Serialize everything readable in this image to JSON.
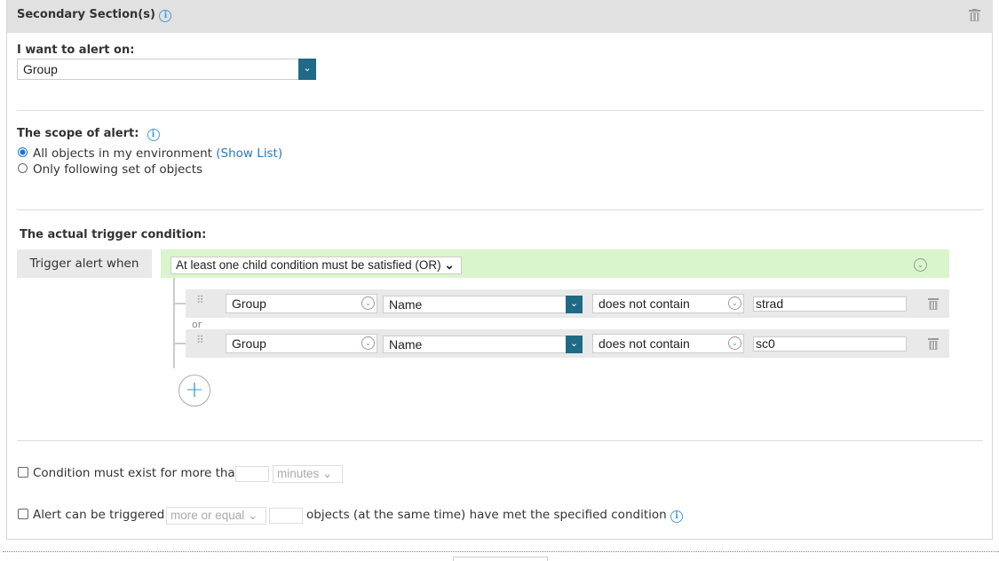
{
  "section": {
    "title": "Secondary Section(s)"
  },
  "alert_on": {
    "label": "I want to alert on:",
    "value": "Group"
  },
  "scope": {
    "label": "The scope of alert:",
    "options": [
      {
        "label": "All objects in my environment",
        "selected": true
      },
      {
        "label": "Only following set of objects",
        "selected": false
      }
    ],
    "show_list": "(Show List)"
  },
  "trigger": {
    "label": "The actual trigger condition:",
    "when_label": "Trigger alert when",
    "mode": "At least one child condition must be satisfied (OR)",
    "joiner": "or",
    "conditions": [
      {
        "object": "Group",
        "property": "Name",
        "operator": "does not contain",
        "value": "strad"
      },
      {
        "object": "Group",
        "property": "Name",
        "operator": "does not contain",
        "value": "sc0"
      }
    ]
  },
  "options": {
    "duration": {
      "label": "Condition must exist for more than",
      "value": "",
      "unit": "minutes",
      "checked": false
    },
    "count": {
      "label": "Alert can be triggered if",
      "comparator": "more or equal",
      "value": "",
      "suffix": "objects (at the same time) have met the specified condition",
      "checked": false
    }
  },
  "colors": {
    "accent": "#1f6a85",
    "header_bg": "#e1e1e1",
    "trigger_bg": "#d9f5cc",
    "link": "#2a7ab8"
  }
}
